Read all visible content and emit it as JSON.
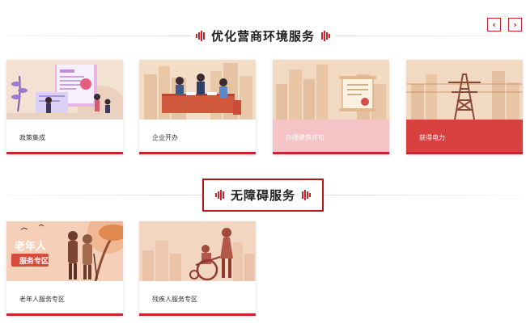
{
  "nav": {
    "prev_icon": "chevron-left-icon",
    "next_icon": "chevron-right-icon",
    "prev_glyph": "‹",
    "next_glyph": "›"
  },
  "section_business": {
    "title": "优化营商环境服务",
    "cards": [
      {
        "label": "政策集成",
        "illustration": "policy-illustration"
      },
      {
        "label": "企业开办",
        "illustration": "business-meeting-illustration"
      },
      {
        "label": "办理建筑许可",
        "illustration": "building-permit-illustration"
      },
      {
        "label": "获得电力",
        "illustration": "power-tower-illustration"
      }
    ]
  },
  "section_accessibility": {
    "title": "无障碍服务",
    "cards": [
      {
        "label": "老年人服务专区",
        "illustration": "elderly-illustration",
        "banner_title": "老年人",
        "banner_sub": "服务专区"
      },
      {
        "label": "残疾人服务专区",
        "illustration": "wheelchair-illustration"
      }
    ]
  },
  "colors": {
    "accent": "#c8252c",
    "pink_label": "#f5c4c7",
    "red_label": "#d94040"
  }
}
